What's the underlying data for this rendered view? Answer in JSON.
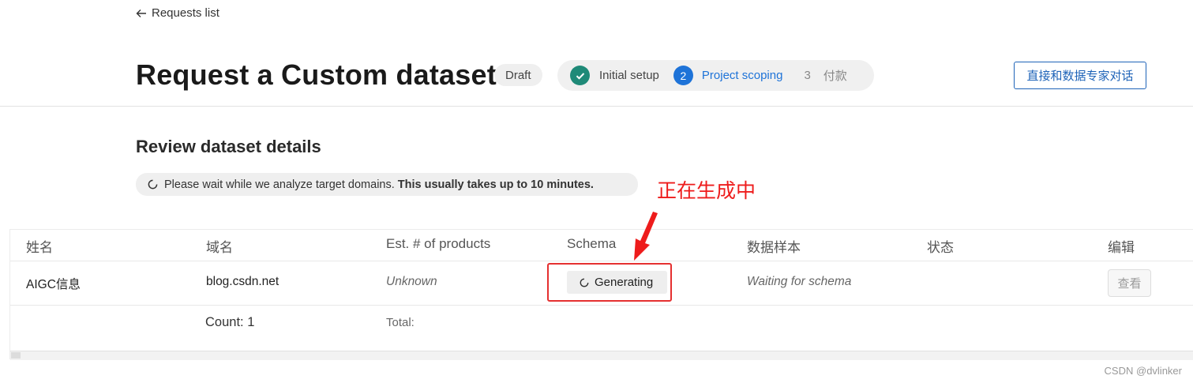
{
  "nav": {
    "back_label": "Requests list"
  },
  "header": {
    "title": "Request a Custom dataset",
    "status_badge": "Draft",
    "steps": [
      {
        "number": "✓",
        "label": "Initial setup",
        "state": "done"
      },
      {
        "number": "2",
        "label": "Project scoping",
        "state": "active"
      },
      {
        "number": "3",
        "label": "付款",
        "state": "pending"
      }
    ],
    "chat_button": "直接和数据专家对话"
  },
  "review": {
    "title": "Review dataset details",
    "wait_text": "Please wait while we analyze target domains.",
    "wait_bold": "This usually takes up to 10 minutes."
  },
  "annotation": {
    "text": "正在生成中",
    "color": "#ee1c1c"
  },
  "table": {
    "columns": [
      "姓名",
      "域名",
      "Est. # of products",
      "Schema",
      "数据样本",
      "状态",
      "编辑"
    ],
    "row": {
      "name": "AIGC信息",
      "domain": "blog.csdn.net",
      "est_products": "Unknown",
      "schema": "Generating",
      "sample": "Waiting for schema",
      "status": "",
      "edit_button": "查看"
    },
    "footer": {
      "count": "Count: 1",
      "total": "Total:"
    }
  },
  "watermark": "CSDN @dvlinker",
  "colors": {
    "accent_blue": "#1e73d8",
    "done_green": "#1f8a78",
    "annotation_red": "#e53030"
  }
}
